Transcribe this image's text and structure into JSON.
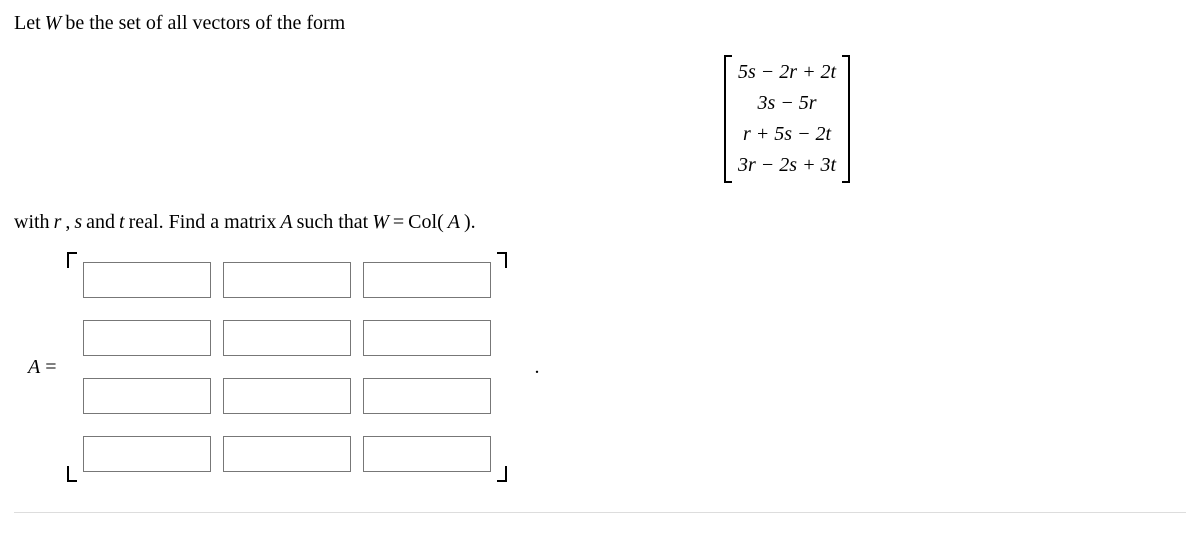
{
  "intro": {
    "prefix": "Let ",
    "set_var": "W",
    "rest": " be the set of all vectors of the form"
  },
  "vector_rows": [
    "5s − 2r + 2t",
    "3s − 5r",
    "r + 5s − 2t",
    "3r − 2s + 3t"
  ],
  "follow": {
    "prefix": "with ",
    "r": "r",
    "comma": ", ",
    "s": "s",
    "and": " and ",
    "t": "t",
    "mid": " real. Find a matrix ",
    "A": "A",
    "mid2": " such that ",
    "W": "W",
    "eq": " = ",
    "col": "Col(",
    "A2": "A",
    "close": ")."
  },
  "answer_label": {
    "A": "A",
    "eq": " ="
  },
  "period": ".",
  "matrix": {
    "rows": 4,
    "cols": 3
  }
}
